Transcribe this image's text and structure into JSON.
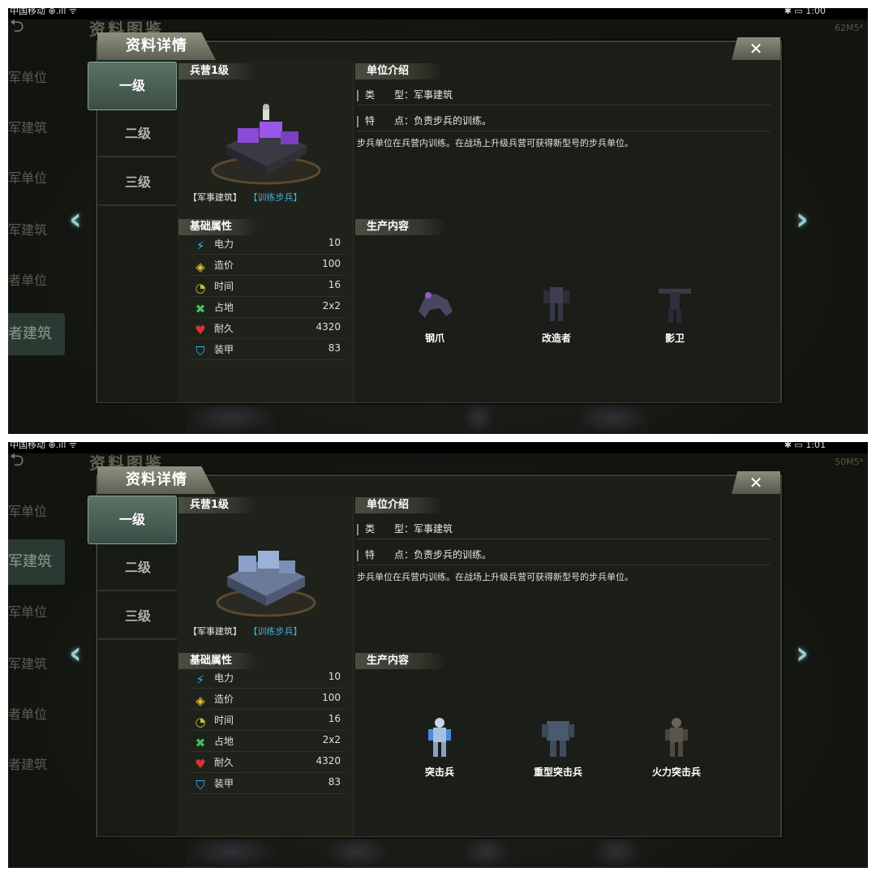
{
  "colors": {
    "accent": "#3ab4d8",
    "active_tab": "#4a6157",
    "dialog_bg": "#1c1e18"
  },
  "shots": [
    {
      "status": {
        "left": "中国移动 ⊕.ıll ᯤ",
        "right": "✱ ▭ 1:00"
      },
      "bg": {
        "title": "资料图鉴",
        "mem": "62M5⁴",
        "categories": [
          "军单位",
          "军建筑",
          "军单位",
          "军建筑",
          "者单位",
          "者建筑"
        ],
        "active_category": 5
      },
      "dialog": {
        "title": "资料详情",
        "close": "✕",
        "levels": [
          "一级",
          "二级",
          "三级"
        ],
        "active_level": 0,
        "name_header": "兵营1级",
        "building_icon": "barracks-purple",
        "tag_category": "【军事建筑】",
        "tag_role": "【训练步兵】",
        "attr_header": "基础属性",
        "attrs": [
          {
            "icon": "lightning-icon",
            "label": "电力",
            "value": "10",
            "color": "#2fb6f0",
            "glyph": "⚡"
          },
          {
            "icon": "cube-icon",
            "label": "造价",
            "value": "100",
            "color": "#e8c020",
            "glyph": "◈"
          },
          {
            "icon": "clock-icon",
            "label": "时间",
            "value": "16",
            "color": "#c8c040",
            "glyph": "◔"
          },
          {
            "icon": "area-icon",
            "label": "占地",
            "value": "2x2",
            "color": "#40c060",
            "glyph": "✖"
          },
          {
            "icon": "heart-icon",
            "label": "耐久",
            "value": "4320",
            "color": "#e03030",
            "glyph": "♥"
          },
          {
            "icon": "shield-icon",
            "label": "装甲",
            "value": "83",
            "color": "#2fb6f0",
            "glyph": "⛉"
          }
        ],
        "intro_header": "单位介绍",
        "type_label": "类　　型：军事建筑",
        "feature_label": "特　　点：负责步兵的训练。",
        "description": "步兵单位在兵营内训练。在战场上升级兵营可获得新型号的步兵单位。",
        "production_header": "生产内容",
        "units": [
          {
            "name": "钢爪",
            "icon": "beast-unit-icon"
          },
          {
            "name": "改造者",
            "icon": "mech-unit-icon"
          },
          {
            "name": "影卫",
            "icon": "shadow-unit-icon"
          }
        ]
      }
    },
    {
      "status": {
        "left": "中国移动 ⊕.ıll ᯤ",
        "right": "✱ ▭ 1:01"
      },
      "bg": {
        "title": "资料图鉴",
        "mem": "50M5⁴",
        "categories": [
          "军单位",
          "军建筑",
          "军单位",
          "军建筑",
          "者单位",
          "者建筑"
        ],
        "active_category": 1
      },
      "dialog": {
        "title": "资料详情",
        "close": "✕",
        "levels": [
          "一级",
          "二级",
          "三级"
        ],
        "active_level": 0,
        "name_header": "兵营1级",
        "building_icon": "barracks-blue",
        "tag_category": "【军事建筑】",
        "tag_role": "【训练步兵】",
        "attr_header": "基础属性",
        "attrs": [
          {
            "icon": "lightning-icon",
            "label": "电力",
            "value": "10",
            "color": "#2fb6f0",
            "glyph": "⚡"
          },
          {
            "icon": "cube-icon",
            "label": "造价",
            "value": "100",
            "color": "#e8c020",
            "glyph": "◈"
          },
          {
            "icon": "clock-icon",
            "label": "时间",
            "value": "16",
            "color": "#c8c040",
            "glyph": "◔"
          },
          {
            "icon": "area-icon",
            "label": "占地",
            "value": "2x2",
            "color": "#40c060",
            "glyph": "✖"
          },
          {
            "icon": "heart-icon",
            "label": "耐久",
            "value": "4320",
            "color": "#e03030",
            "glyph": "♥"
          },
          {
            "icon": "shield-icon",
            "label": "装甲",
            "value": "83",
            "color": "#2fb6f0",
            "glyph": "⛉"
          }
        ],
        "intro_header": "单位介绍",
        "type_label": "类　　型：军事建筑",
        "feature_label": "特　　点：负责步兵的训练。",
        "description": "步兵单位在兵营内训练。在战场上升级兵营可获得新型号的步兵单位。",
        "production_header": "生产内容",
        "units": [
          {
            "name": "突击兵",
            "icon": "assault-unit-icon"
          },
          {
            "name": "重型突击兵",
            "icon": "heavy-assault-unit-icon"
          },
          {
            "name": "火力突击兵",
            "icon": "fire-assault-unit-icon"
          }
        ]
      }
    }
  ]
}
